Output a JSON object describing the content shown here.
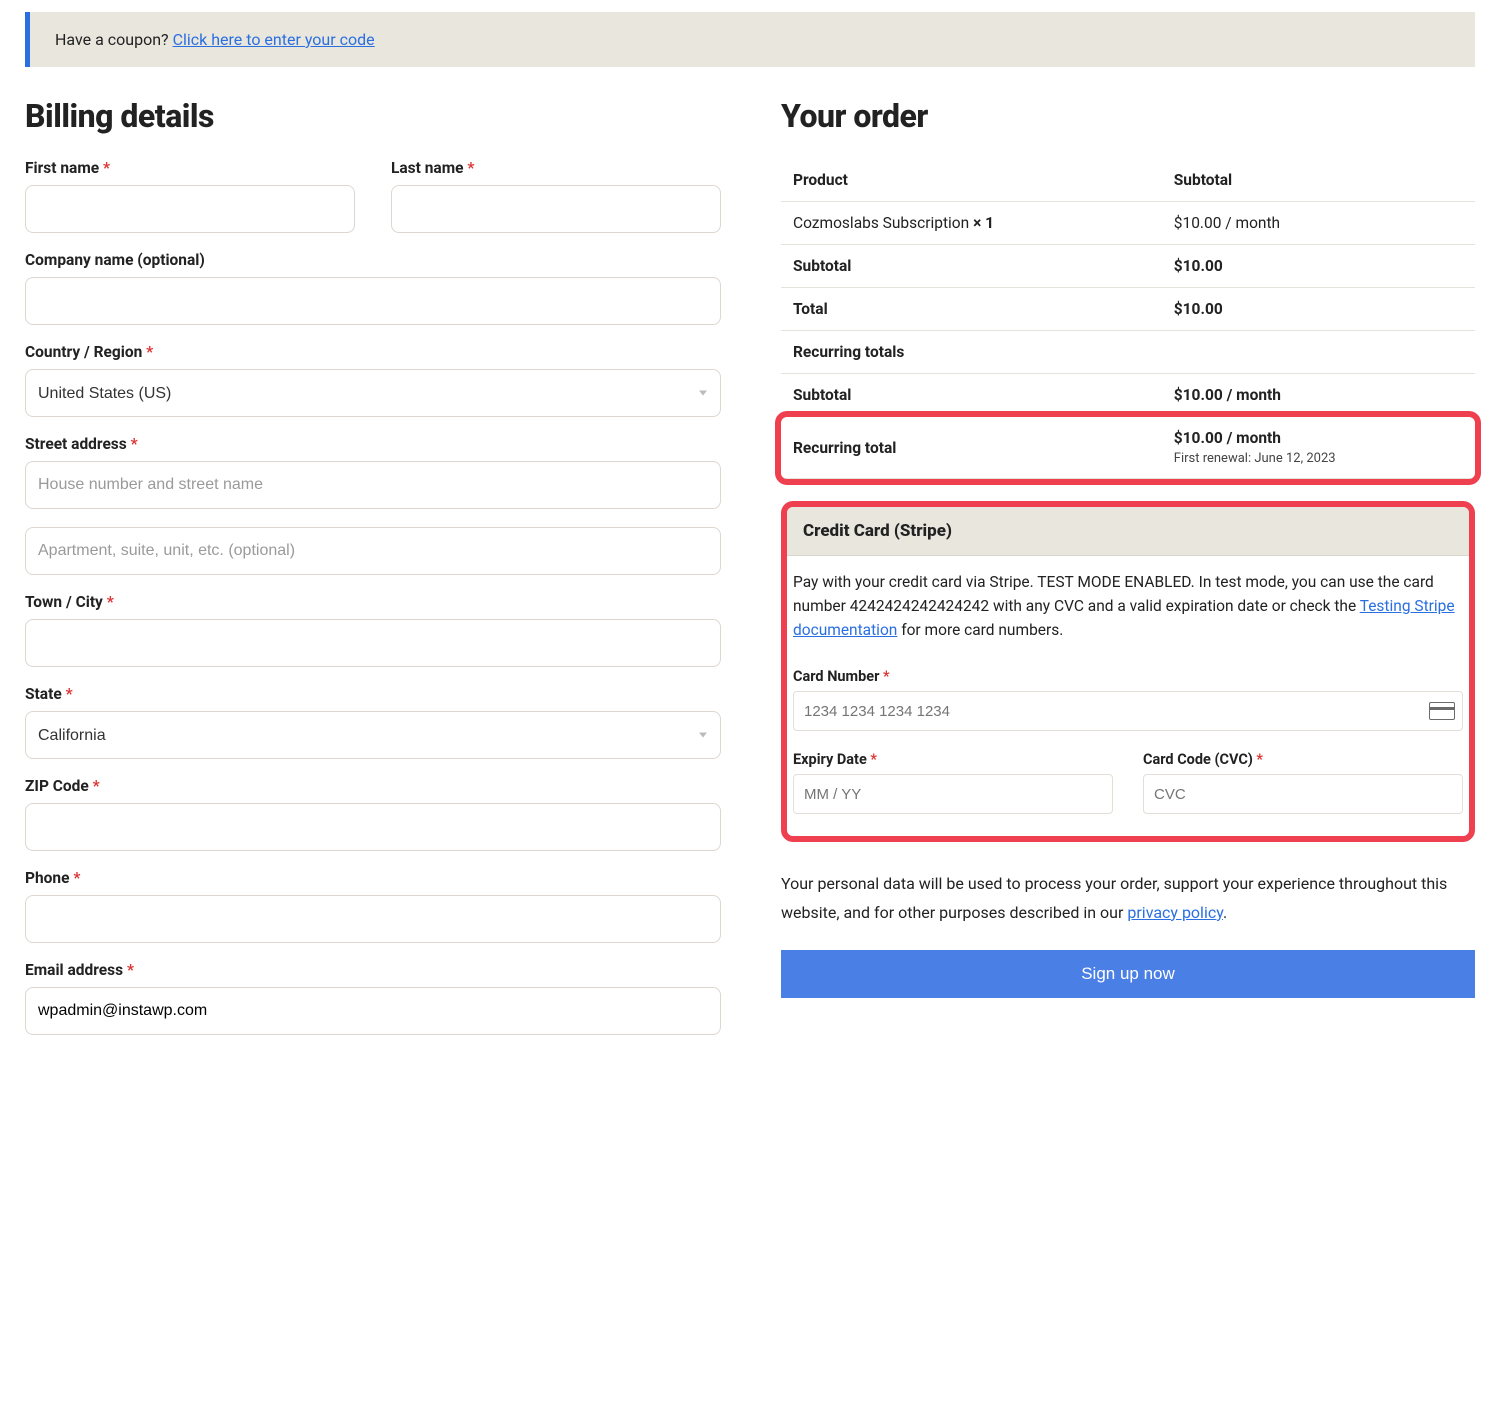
{
  "coupon": {
    "prefix": "Have a coupon? ",
    "link": "Click here to enter your code"
  },
  "billing": {
    "title": "Billing details",
    "first_name": "First name",
    "last_name": "Last name",
    "company": "Company name (optional)",
    "country": "Country / Region",
    "country_value": "United States (US)",
    "street": "Street address",
    "street_ph": "House number and street name",
    "street2_ph": "Apartment, suite, unit, etc. (optional)",
    "city": "Town / City",
    "state": "State",
    "state_value": "California",
    "zip": "ZIP Code",
    "phone": "Phone",
    "email": "Email address",
    "email_value": "wpadmin@instawp.com"
  },
  "order": {
    "title": "Your order",
    "th_product": "Product",
    "th_subtotal": "Subtotal",
    "product_name": "Cozmoslabs Subscription ",
    "product_qty": " × 1",
    "product_price": "$10.00 / month",
    "subtotal_label": "Subtotal",
    "subtotal_value": "$10.00",
    "total_label": "Total",
    "total_value": "$10.00",
    "recurring_header": "Recurring totals",
    "recurring_sub_label": "Subtotal",
    "recurring_sub_value": "$10.00 / month",
    "recurring_total_label": "Recurring total",
    "recurring_total_value": "$10.00 / month",
    "renewal_note": "First renewal: June 12, 2023"
  },
  "card": {
    "header": "Credit Card (Stripe)",
    "desc_pre": "Pay with your credit card via Stripe. TEST MODE ENABLED. In test mode, you can use the card number 4242424242424242 with any CVC and a valid expiration date or check the ",
    "desc_link": "Testing Stripe documentation",
    "desc_post": " for more card numbers.",
    "number_label": "Card Number",
    "number_ph": "1234 1234 1234 1234",
    "expiry_label": "Expiry Date",
    "expiry_ph": "MM / YY",
    "cvc_label": "Card Code (CVC)",
    "cvc_ph": "CVC"
  },
  "privacy": {
    "text_pre": "Your personal data will be used to process your order, support your experience throughout this website, and for other purposes described in our ",
    "link": "privacy policy",
    "text_post": "."
  },
  "button": {
    "label": "Sign up now"
  },
  "asterisk": "*"
}
